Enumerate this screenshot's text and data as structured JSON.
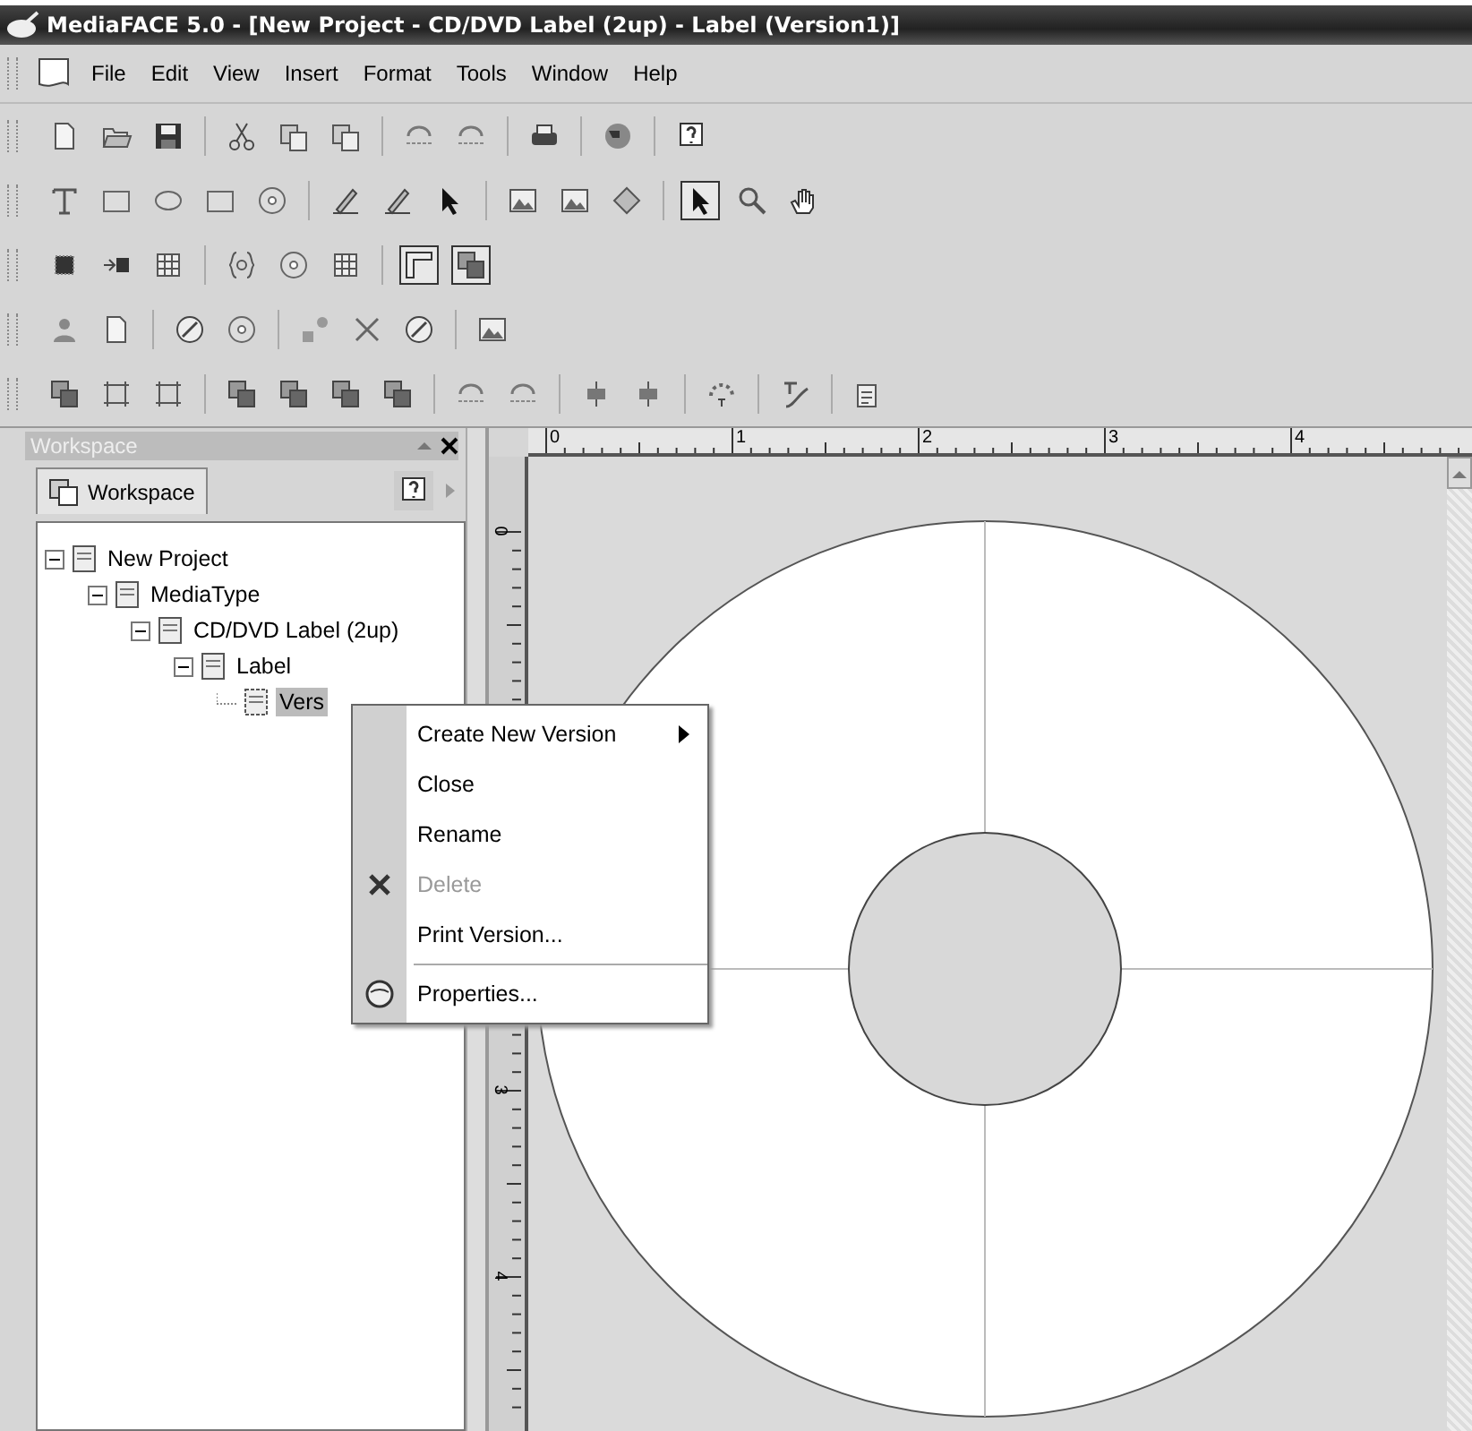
{
  "window": {
    "title": "MediaFACE 5.0 - [New Project - CD/DVD Label (2up) - Label (Version1)]"
  },
  "menu_bar": [
    "File",
    "Edit",
    "View",
    "Insert",
    "Format",
    "Tools",
    "Window",
    "Help"
  ],
  "toolbars": [
    {
      "groups": [
        [
          {
            "pressed": false
          },
          {
            "pressed": false
          },
          {
            "pressed": false
          }
        ],
        [
          {
            "pressed": false
          },
          {
            "pressed": false
          },
          {
            "pressed": false
          }
        ],
        [
          {
            "pressed": false
          },
          {
            "pressed": false
          }
        ],
        [
          {
            "pressed": false
          }
        ],
        [
          {
            "pressed": false
          }
        ],
        [
          {
            "pressed": false
          }
        ]
      ]
    },
    {
      "groups": [
        [
          {
            "pressed": false
          },
          {
            "pressed": false
          },
          {
            "pressed": false
          },
          {
            "pressed": false
          },
          {
            "pressed": false
          }
        ],
        [
          {
            "pressed": false
          },
          {
            "pressed": false
          },
          {
            "pressed": false
          }
        ],
        [
          {
            "pressed": false
          },
          {
            "pressed": false
          },
          {
            "pressed": false
          }
        ],
        [
          {
            "pressed": true
          },
          {
            "pressed": false
          },
          {
            "pressed": false
          }
        ]
      ]
    },
    {
      "groups": [
        [
          {
            "pressed": false
          },
          {
            "pressed": false
          },
          {
            "pressed": false
          }
        ],
        [
          {
            "pressed": false
          },
          {
            "pressed": false
          },
          {
            "pressed": false
          }
        ],
        [
          {
            "pressed": true
          },
          {
            "pressed": true
          }
        ]
      ]
    },
    {
      "groups": [
        [
          {
            "pressed": false
          },
          {
            "pressed": false
          }
        ],
        [
          {
            "pressed": false
          },
          {
            "pressed": false
          }
        ],
        [
          {
            "pressed": false
          },
          {
            "pressed": false
          },
          {
            "pressed": false
          }
        ],
        [
          {
            "pressed": false
          }
        ]
      ]
    },
    {
      "groups": [
        [
          {
            "pressed": false
          },
          {
            "pressed": false
          },
          {
            "pressed": false
          }
        ],
        [
          {
            "pressed": false
          },
          {
            "pressed": false
          },
          {
            "pressed": false
          },
          {
            "pressed": false
          }
        ],
        [
          {
            "pressed": false
          },
          {
            "pressed": false
          }
        ],
        [
          {
            "pressed": false
          },
          {
            "pressed": false
          }
        ],
        [
          {
            "pressed": false
          }
        ],
        [
          {
            "pressed": false
          }
        ],
        [
          {
            "pressed": false
          }
        ]
      ]
    }
  ],
  "workspace": {
    "title": "Workspace",
    "tab": "Workspace",
    "tree": [
      {
        "label": "New Project",
        "expanded": true,
        "selected": false,
        "children": [
          {
            "label": "MediaType",
            "expanded": true,
            "selected": false,
            "children": [
              {
                "label": "CD/DVD Label (2up)",
                "expanded": true,
                "selected": false,
                "children": [
                  {
                    "label": "Label",
                    "expanded": true,
                    "selected": false,
                    "children": [
                      {
                        "label": "Vers",
                        "selected": true
                      }
                    ]
                  }
                ]
              }
            ]
          }
        ]
      }
    ]
  },
  "rulers": {
    "horizontal": [
      "0",
      "1",
      "2",
      "3",
      "4"
    ],
    "vertical": [
      "0",
      "3",
      "4"
    ]
  },
  "context_menu": [
    {
      "label": "Create New Version",
      "submenu": true,
      "disabled": false
    },
    {
      "label": "Close",
      "disabled": false
    },
    {
      "label": "Rename",
      "disabled": false
    },
    {
      "label": "Delete",
      "disabled": true
    },
    {
      "label": "Print Version...",
      "disabled": false
    },
    {
      "label": "Properties...",
      "disabled": false,
      "separator_before": true
    }
  ]
}
